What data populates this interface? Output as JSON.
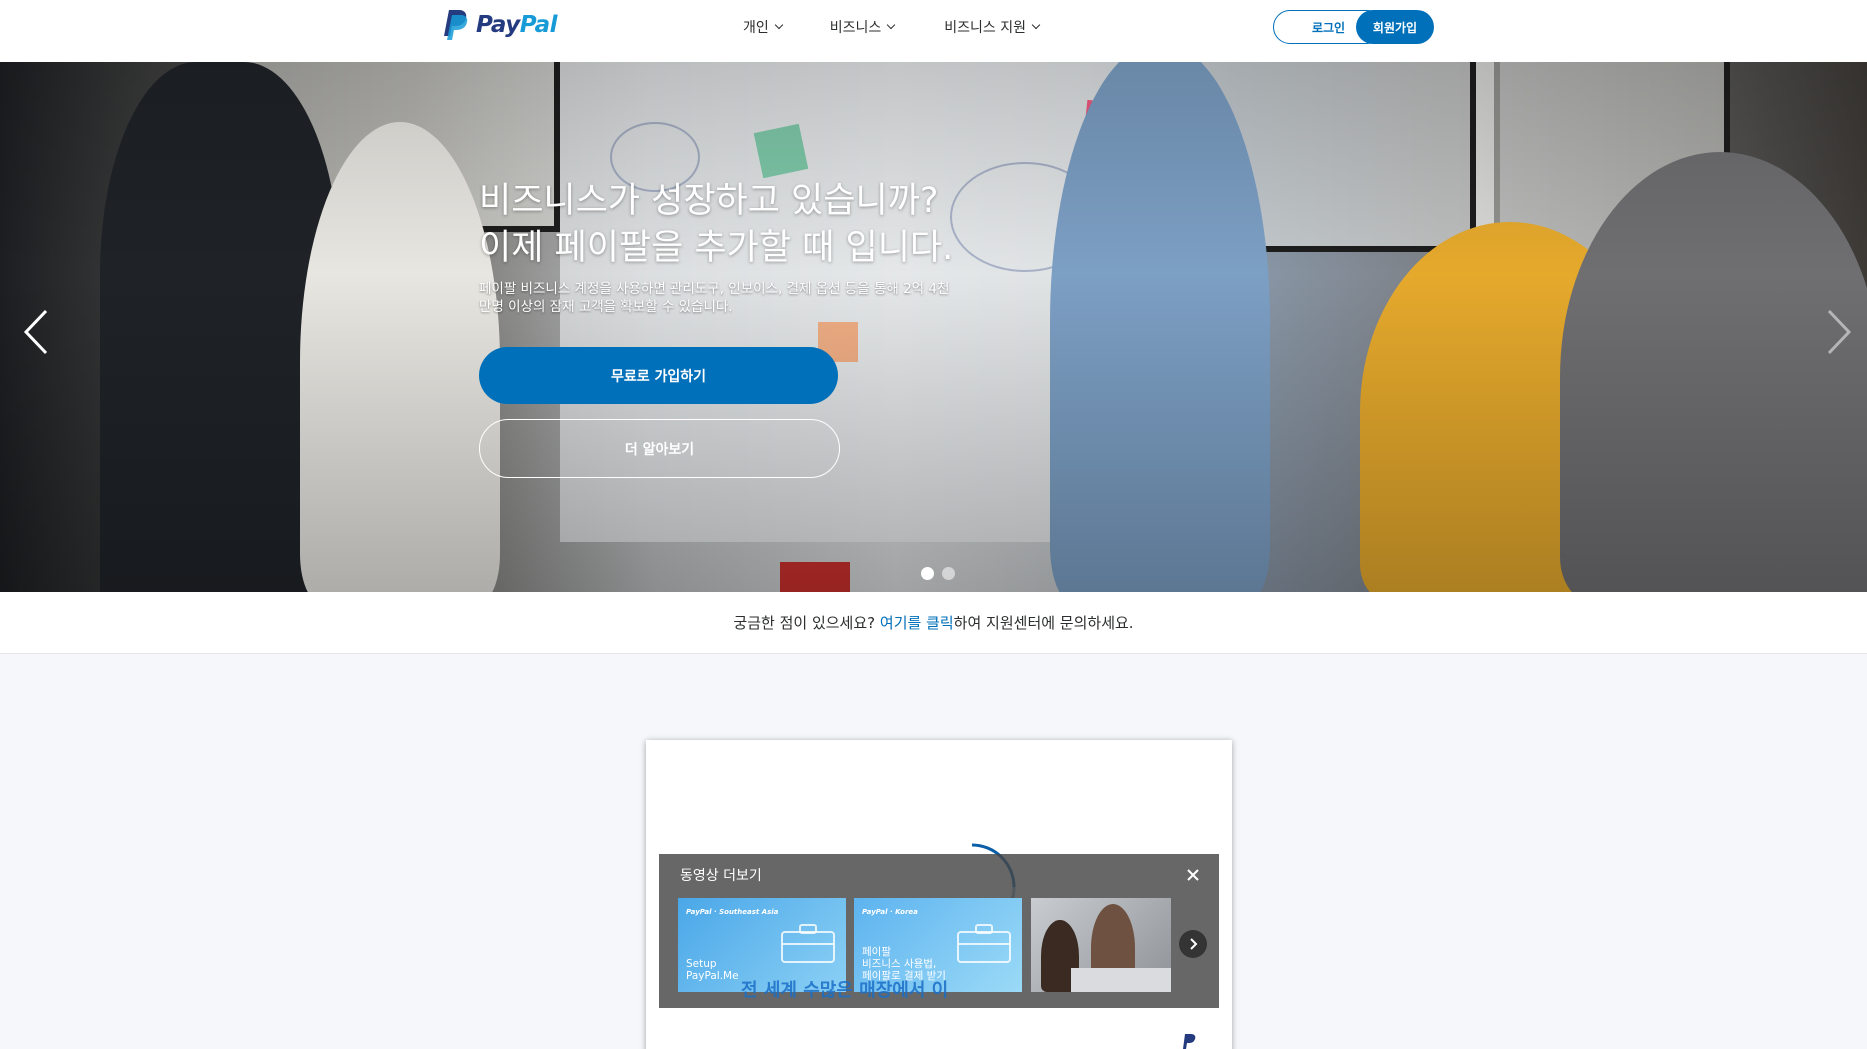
{
  "header": {
    "logo_text_pay": "Pay",
    "logo_text_pal": "Pal",
    "nav": [
      {
        "label": "개인"
      },
      {
        "label": "비즈니스"
      },
      {
        "label": "비즈니스 지원"
      }
    ],
    "login_label": "로그인",
    "signup_label": "회원가입"
  },
  "hero": {
    "title_line1": "비즈니스가 성장하고 있습니까?",
    "title_line2": "이제 페이팔을 추가할 때 입니다.",
    "subtitle_line1": "페이팔 비즈니스 계정을 사용하면 관리도구, 인보이스, 결제 옵션 등을 통해 2억 4천",
    "subtitle_line2": "만명 이상의 잠재 고객을 확보할 수 있습니다.",
    "primary_cta": "무료로 가입하기",
    "secondary_cta": "더 알아보기",
    "slide_count": 2,
    "active_slide": 1
  },
  "help": {
    "prefix": "궁금한 점이 있으세요? ",
    "link": "여기를 클릭",
    "suffix": "하여 지원센터에 문의하세요."
  },
  "video": {
    "more_title": "동영상 더보기",
    "thumbs": [
      {
        "brand": "PayPal · Southeast Asia",
        "caption_line1": "Setup",
        "caption_line2": "PayPal.Me",
        "caption_line3": ""
      },
      {
        "brand": "PayPal · Korea",
        "caption_line1": "페이팔",
        "caption_line2": "비즈니스 사용법,",
        "caption_line3": "페이팔로 결제 받기"
      },
      {
        "brand": "",
        "caption_line1": "",
        "caption_line2": "",
        "caption_line3": ""
      }
    ],
    "marquee_text": "전 세계 수많은 매장에서 이"
  },
  "colors": {
    "brand_blue": "#0070ba",
    "logo_dark": "#253b80",
    "logo_light": "#179bd7"
  }
}
